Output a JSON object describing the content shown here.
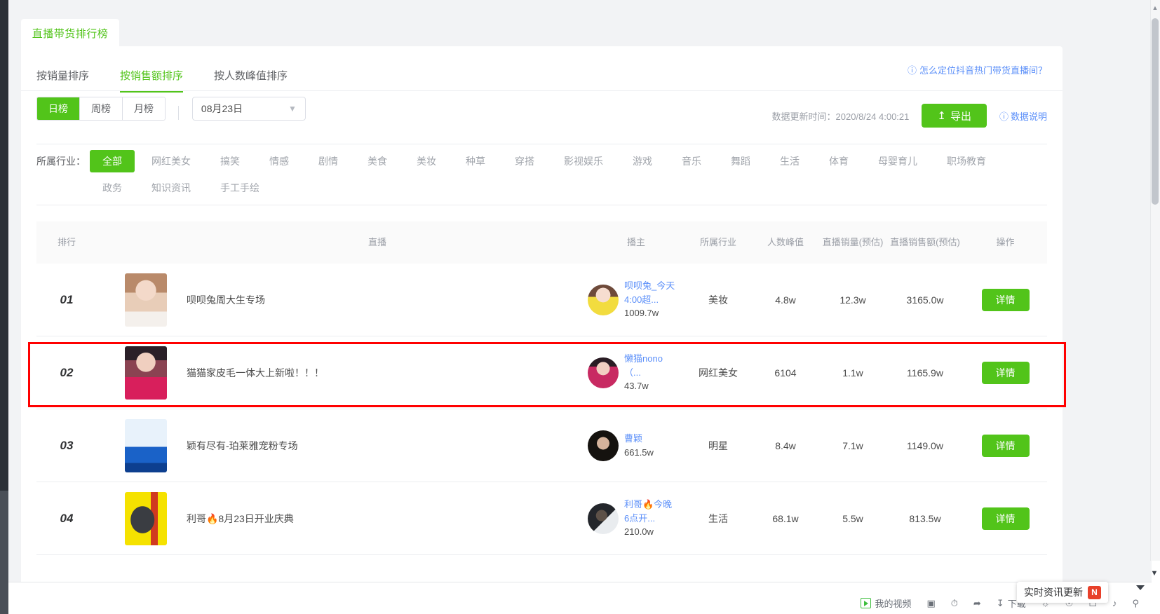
{
  "tab_head": {
    "label": "直播带货排行榜"
  },
  "sort_tabs": [
    {
      "label": "按销量排序",
      "active": false
    },
    {
      "label": "按销售额排序",
      "active": true
    },
    {
      "label": "按人数峰值排序",
      "active": false
    }
  ],
  "help_link": {
    "icon": "question-circle-icon",
    "label": "怎么定位抖音热门带货直播间？"
  },
  "period": {
    "options": [
      {
        "label": "日榜",
        "active": true
      },
      {
        "label": "周榜",
        "active": false
      },
      {
        "label": "月榜",
        "active": false
      }
    ]
  },
  "date_picker": {
    "value": "08月23日",
    "icon": "chevron-down-icon"
  },
  "update_time": {
    "label": "数据更新时间：",
    "value": "2020/8/24 4:00:21",
    "full": "数据更新时间：2020/8/24 4:00:21"
  },
  "export_button": {
    "label": "导出",
    "icon": "upload-icon"
  },
  "data_note": {
    "icon": "question-circle-icon",
    "label": "数据说明"
  },
  "industry_filter": {
    "label": "所属行业：",
    "chips": [
      {
        "label": "全部",
        "active": true
      },
      {
        "label": "网红美女",
        "active": false
      },
      {
        "label": "搞笑",
        "active": false
      },
      {
        "label": "情感",
        "active": false
      },
      {
        "label": "剧情",
        "active": false
      },
      {
        "label": "美食",
        "active": false
      },
      {
        "label": "美妆",
        "active": false
      },
      {
        "label": "种草",
        "active": false
      },
      {
        "label": "穿搭",
        "active": false
      },
      {
        "label": "影视娱乐",
        "active": false
      },
      {
        "label": "游戏",
        "active": false
      },
      {
        "label": "音乐",
        "active": false
      },
      {
        "label": "舞蹈",
        "active": false
      },
      {
        "label": "生活",
        "active": false
      },
      {
        "label": "体育",
        "active": false
      },
      {
        "label": "母婴育儿",
        "active": false
      },
      {
        "label": "职场教育",
        "active": false
      },
      {
        "label": "政务",
        "active": false
      },
      {
        "label": "知识资讯",
        "active": false
      },
      {
        "label": "手工手绘",
        "active": false
      }
    ]
  },
  "table": {
    "headers": {
      "rank": "排行",
      "live": "直播",
      "host": "播主",
      "industry": "所属行业",
      "peak": "人数峰值",
      "volume": "直播销量(预估)",
      "amount": "直播销售额(预估)",
      "action": "操作"
    },
    "rows": [
      {
        "rank": "01",
        "live_title": "呗呗兔周大生专场",
        "host_name": "呗呗兔_今天4:00超...",
        "host_fans": "1009.7w",
        "industry": "美妆",
        "peak": "4.8w",
        "volume": "12.3w",
        "amount": "3165.0w",
        "action": "详情",
        "highlighted": false
      },
      {
        "rank": "02",
        "live_title": "猫猫家皮毛一体大上新啦！！！",
        "host_name": "懒猫nono（...",
        "host_fans": "43.7w",
        "industry": "网红美女",
        "peak": "6104",
        "volume": "1.1w",
        "amount": "1165.9w",
        "action": "详情",
        "highlighted": true
      },
      {
        "rank": "03",
        "live_title": "颖有尽有-珀莱雅宠粉专场",
        "host_name": "曹颖",
        "host_fans": "661.5w",
        "industry": "明星",
        "peak": "8.4w",
        "volume": "7.1w",
        "amount": "1149.0w",
        "action": "详情",
        "highlighted": false
      },
      {
        "rank": "04",
        "live_title": "利哥🔥8月23日开业庆典",
        "host_name": "利哥🔥今晚6点开...",
        "host_fans": "210.0w",
        "industry": "生活",
        "peak": "68.1w",
        "volume": "5.5w",
        "amount": "813.5w",
        "action": "详情",
        "highlighted": false
      }
    ]
  },
  "bottom_bar": {
    "my_video": "我的视频",
    "download": "下载",
    "toast": {
      "label": "实时资讯更新",
      "badge": "N"
    }
  },
  "colors": {
    "brand_green": "#52c41a",
    "link_blue": "#5b8ff9",
    "highlight_red": "#ff0000"
  }
}
